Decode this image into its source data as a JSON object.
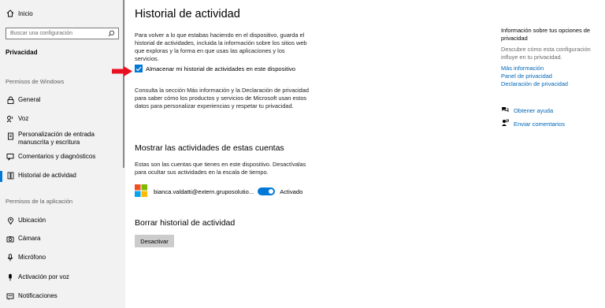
{
  "sidebar": {
    "home_label": "Inicio",
    "search_placeholder": "Buscar una configuración",
    "section_title": "Privacidad",
    "group_windows": "Permisos de Windows",
    "items_windows": [
      {
        "label": "General",
        "icon": "lock-icon"
      },
      {
        "label": "Voz",
        "icon": "speech-icon"
      },
      {
        "label": "Personalización de entrada manuscrita y escritura",
        "icon": "pen-icon"
      },
      {
        "label": "Comentarios y diagnósticos",
        "icon": "feedback-icon"
      },
      {
        "label": "Historial de actividad",
        "icon": "history-icon",
        "active": true
      }
    ],
    "group_apps": "Permisos de la aplicación",
    "items_apps": [
      {
        "label": "Ubicación",
        "icon": "location-icon"
      },
      {
        "label": "Cámara",
        "icon": "camera-icon"
      },
      {
        "label": "Micrófono",
        "icon": "microphone-icon"
      },
      {
        "label": "Activación por voz",
        "icon": "voice-activation-icon"
      },
      {
        "label": "Notificaciones",
        "icon": "notification-icon"
      }
    ]
  },
  "main": {
    "title": "Historial de actividad",
    "intro": "Para volver a lo que estabas haciendo en el dispositivo, guarda el historial de actividades, incluida la información sobre los sitios web que exploras y la forma en que usas las aplicaciones y los servicios.",
    "checkbox_label": "Almacenar mi historial de actividades en este dispositivo",
    "checkbox_checked": true,
    "privacy_text": "Consulta la sección Más información y la Declaración de privacidad para saber cómo los productos y servicios de Microsoft usan estos datos para personalizar experiencias y respetar tu privacidad.",
    "accounts_heading": "Mostrar las actividades de estas cuentas",
    "accounts_text": "Estas son las cuentas que tienes en este dispositivo. Desactívalas para ocultar sus actividades en la escala de tiempo.",
    "account_email": "bianca.valdatti@extern.gruposolutio...",
    "account_toggle_state": "Activado",
    "account_toggle_on": true,
    "clear_heading": "Borrar historial de actividad",
    "clear_button": "Desactivar"
  },
  "right_panel": {
    "heading": "Información sobre tus opciones de privacidad",
    "description": "Descubre cómo esta configuración influye en tu privacidad.",
    "links": [
      "Más información",
      "Panel de privacidad",
      "Declaración de privacidad"
    ],
    "help_link": "Obtener ayuda",
    "feedback_link": "Enviar comentarios"
  },
  "colors": {
    "accent": "#0078d7",
    "link": "#0067b8",
    "sidebar_bg": "#f2f2f2",
    "annotation_arrow": "#e81123",
    "ms_logo": [
      "#f25022",
      "#7fba00",
      "#00a4ef",
      "#ffb900"
    ]
  }
}
